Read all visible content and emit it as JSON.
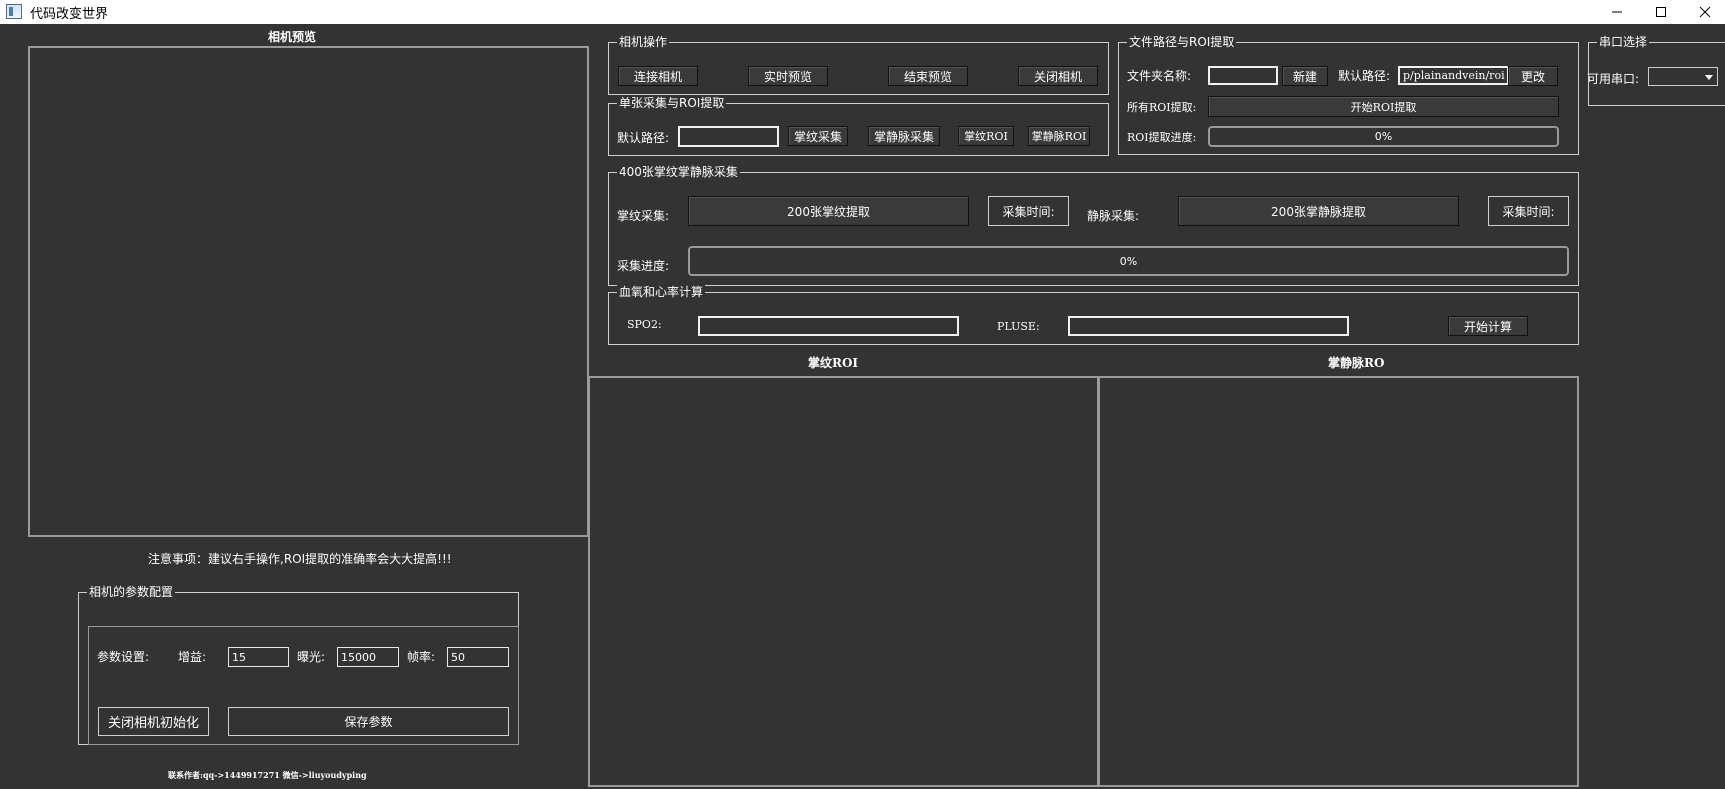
{
  "window": {
    "title": "代码改变世界"
  },
  "camera_preview": {
    "title": "相机预览",
    "notice": "注意事项：建议右手操作,ROI提取的准确率会大大提高!!!"
  },
  "camera_params": {
    "group_title": "相机的参数配置",
    "params_label": "参数设置:",
    "gain_label": "增益:",
    "gain_value": "15",
    "exposure_label": "曝光:",
    "exposure_value": "15000",
    "framerate_label": "帧率:",
    "framerate_value": "50",
    "close_init_button": "关闭相机初始化",
    "save_button": "保存参数"
  },
  "contact": "联系作者:qq->1449917271   微信->liuyoudyping",
  "camera_ops": {
    "group_title": "相机操作",
    "connect": "连接相机",
    "live_preview": "实时预览",
    "end_preview": "结束预览",
    "close_camera": "关闭相机"
  },
  "single_capture": {
    "group_title": "单张采集与ROI提取",
    "path_label": "默认路径:",
    "path_value": "",
    "palmprint_capture": "掌纹采集",
    "palmvein_capture": "掌静脉采集",
    "palmprint_roi": "掌纹ROI",
    "palmvein_roi": "掌静脉ROI"
  },
  "file_roi": {
    "group_title": "文件路径与ROI提取",
    "folder_label": "文件夹名称:",
    "folder_value": "",
    "new_button": "新建",
    "default_path_label": "默认路径:",
    "default_path_value": "p/plainandvein/roi",
    "change_button": "更改",
    "all_roi_label": "所有ROI提取:",
    "start_roi_button": "开始ROI提取",
    "progress_label": "ROI提取进度:",
    "progress_text": "0%",
    "progress_value": 0
  },
  "serial": {
    "group_title": "串口选择",
    "available_label": "可用串口:",
    "selected": ""
  },
  "batch_capture": {
    "group_title": "400张掌纹掌静脉采集",
    "palmprint_label": "掌纹采集:",
    "palmprint_button": "200张掌纹提取",
    "capture_time_1": "采集时间:",
    "vein_label": "静脉采集:",
    "vein_button": "200张掌静脉提取",
    "capture_time_2": "采集时间:",
    "progress_label": "采集进度:",
    "progress_text": "0%",
    "progress_value": 0
  },
  "spo2": {
    "group_title": "血氧和心率计算",
    "spo2_label": "SPO2:",
    "spo2_value": "",
    "pulse_label": "PLUSE:",
    "pulse_value": "",
    "start_button": "开始计算"
  },
  "roi_views": {
    "palmprint_title": "掌纹ROI",
    "palmvein_title": "掌静脉ROI"
  }
}
